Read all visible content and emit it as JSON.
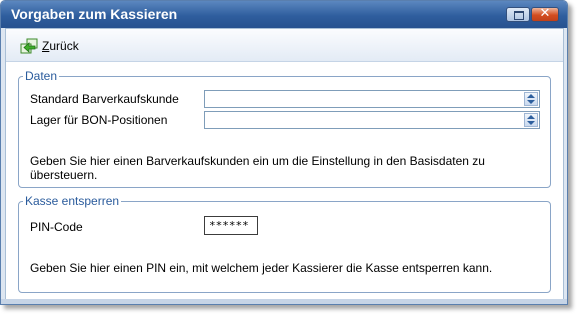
{
  "window": {
    "title": "Vorgaben zum Kassieren"
  },
  "toolbar": {
    "back_label_accel": "Z",
    "back_label_rest": "urück"
  },
  "daten": {
    "legend": "Daten",
    "customer_label": "Standard Barverkaufskunde",
    "customer_value": "",
    "warehouse_label": "Lager für BON-Positionen",
    "warehouse_value": "",
    "hint": "Geben Sie hier einen Barverkaufskunden ein um die Einstellung in den Basisdaten zu übersteuern."
  },
  "kasse": {
    "legend": "Kasse entsperren",
    "pin_label": "PIN-Code",
    "pin_value": "******",
    "hint": "Geben Sie hier einen PIN ein, mit welchem jeder Kassierer die Kasse entsperren kann."
  },
  "icons": {
    "back": "arrow-left-icon",
    "restore": "restore-window-icon",
    "close": "close-icon",
    "spinner": "spinner-icon"
  },
  "colors": {
    "titlebar": "#2f5e9e",
    "legend_text": "#2a5b9c",
    "group_border": "#8aa5c7",
    "close_button": "#d34d1f"
  }
}
